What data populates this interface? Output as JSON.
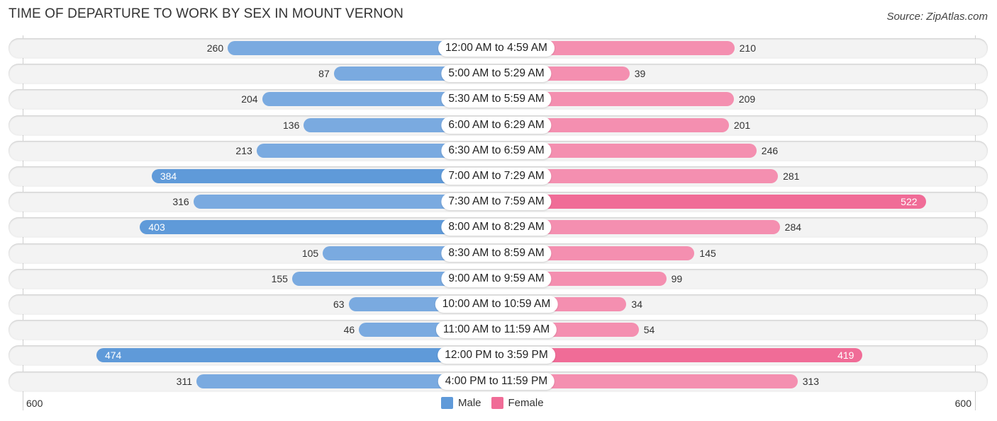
{
  "title": "TIME OF DEPARTURE TO WORK BY SEX IN MOUNT VERNON",
  "source": "Source: ZipAtlas.com",
  "colors": {
    "male": "#7aaae0",
    "female": "#f48fb0",
    "male_strong": "#5f9ad9",
    "female_strong": "#f06c97"
  },
  "chart_data": {
    "type": "bar",
    "orientation": "horizontal-diverging",
    "title": "TIME OF DEPARTURE TO WORK BY SEX IN MOUNT VERNON",
    "categories": [
      "12:00 AM to 4:59 AM",
      "5:00 AM to 5:29 AM",
      "5:30 AM to 5:59 AM",
      "6:00 AM to 6:29 AM",
      "6:30 AM to 6:59 AM",
      "7:00 AM to 7:29 AM",
      "7:30 AM to 7:59 AM",
      "8:00 AM to 8:29 AM",
      "8:30 AM to 8:59 AM",
      "9:00 AM to 9:59 AM",
      "10:00 AM to 10:59 AM",
      "11:00 AM to 11:59 AM",
      "12:00 PM to 3:59 PM",
      "4:00 PM to 11:59 PM"
    ],
    "series": [
      {
        "name": "Male",
        "values": [
          260,
          87,
          204,
          136,
          213,
          384,
          316,
          403,
          105,
          155,
          63,
          46,
          474,
          311
        ]
      },
      {
        "name": "Female",
        "values": [
          210,
          39,
          209,
          201,
          246,
          281,
          522,
          284,
          145,
          99,
          34,
          54,
          419,
          313
        ]
      }
    ],
    "axis": {
      "left_tick": "600",
      "right_tick": "600",
      "range": [
        0,
        600
      ]
    },
    "legend": {
      "position": "bottom-center",
      "entries": [
        "Male",
        "Female"
      ]
    }
  }
}
